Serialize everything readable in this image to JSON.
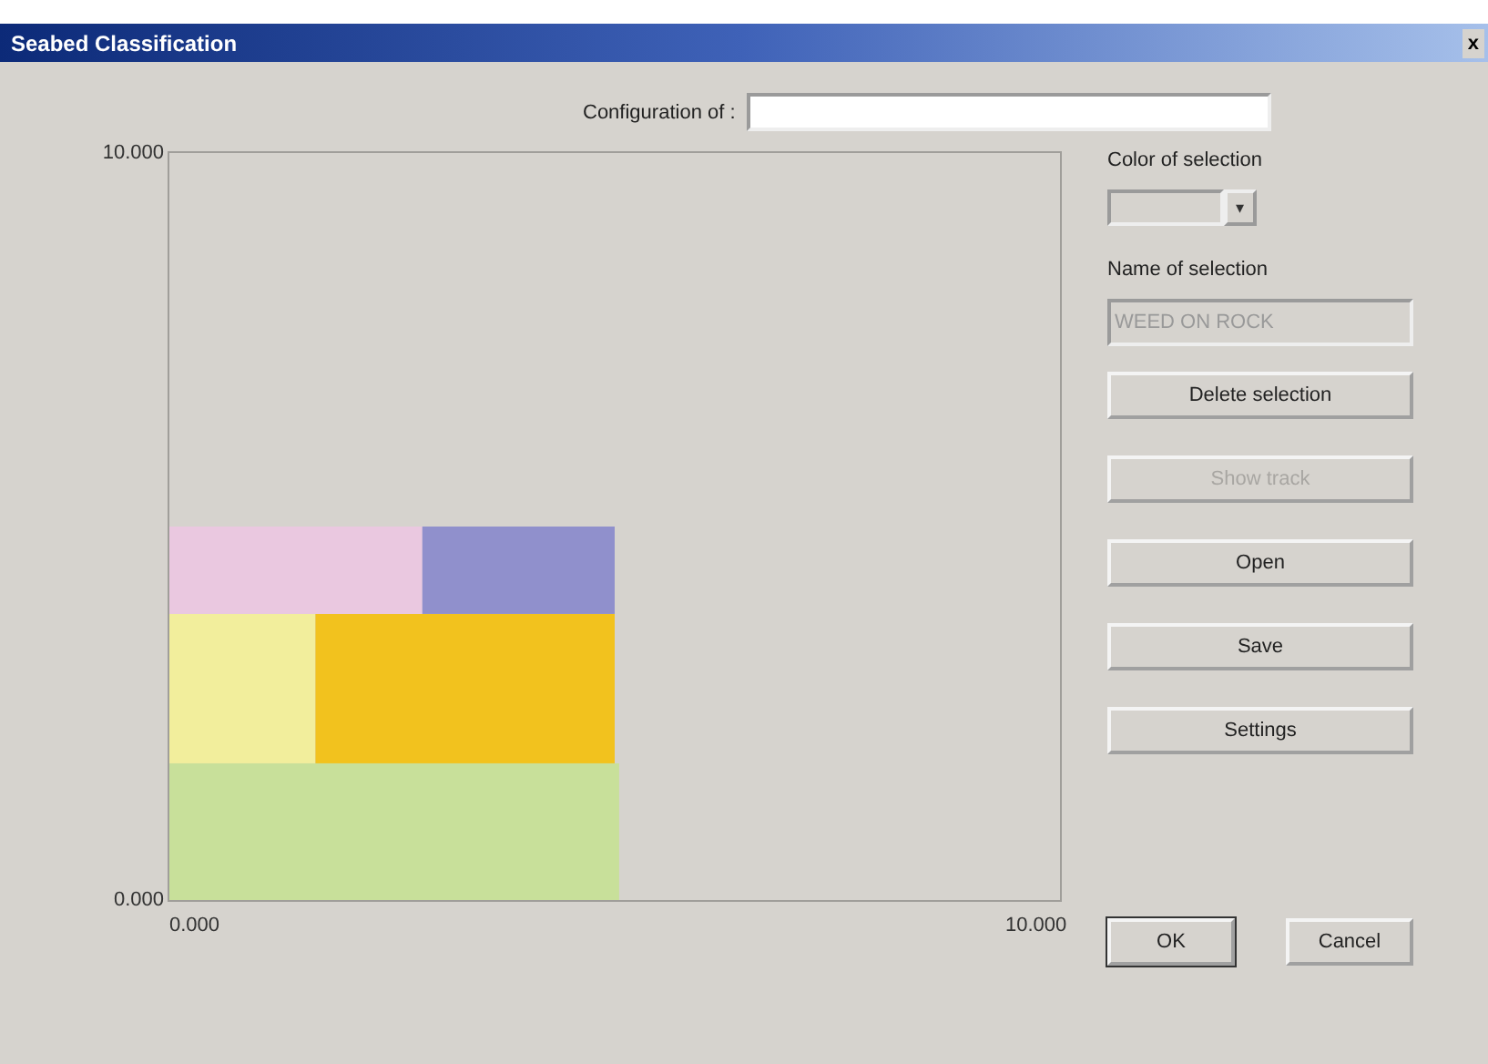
{
  "window": {
    "title": "Seabed Classification",
    "close": "x"
  },
  "configuration": {
    "label": "Configuration of :"
  },
  "plot": {
    "y_axis_labels": [
      "10.000",
      "0.000"
    ],
    "x_axis_labels": [
      "0.000",
      "10.000"
    ],
    "regions": [
      {
        "color": "#c8e09a"
      },
      {
        "color": "#f2ee9c"
      },
      {
        "color": "#f2c21e"
      },
      {
        "color": "#eac8e0"
      },
      {
        "color": "#9090cc"
      }
    ]
  },
  "color_of_selection": {
    "label": "Color of selection",
    "arrow": "▾"
  },
  "name_of_selection": {
    "label": "Name of selection",
    "value": "WEED ON ROCK",
    "disabled": true
  },
  "actions": [
    {
      "label": "Delete selection",
      "disabled": false
    },
    {
      "label": "Show track",
      "disabled": true
    },
    {
      "label": "Open",
      "disabled": false
    },
    {
      "label": "Save",
      "disabled": false
    },
    {
      "label": "Settings",
      "disabled": false
    }
  ],
  "footer": [
    {
      "label": "OK",
      "default": true
    },
    {
      "label": "Cancel",
      "default": false
    }
  ]
}
